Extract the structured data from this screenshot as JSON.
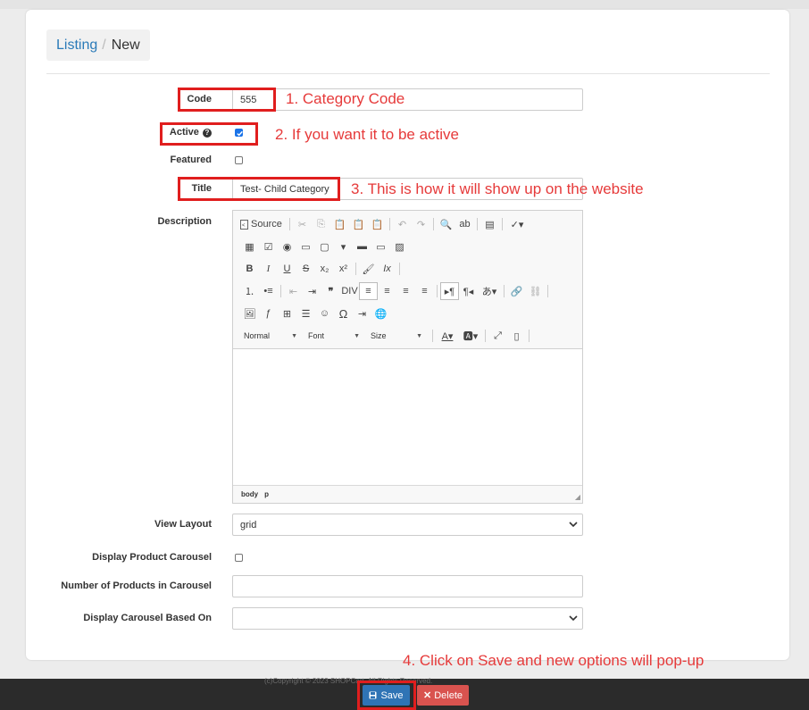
{
  "breadcrumb": {
    "link": "Listing",
    "separator": "/",
    "current": "New"
  },
  "form": {
    "code_label": "Code",
    "code_value": "555",
    "active_label": "Active",
    "active_checked": true,
    "featured_label": "Featured",
    "featured_checked": false,
    "title_label": "Title",
    "title_value": "Test- Child Category",
    "description_label": "Description",
    "view_layout_label": "View Layout",
    "view_layout_value": "grid",
    "display_carousel_label": "Display Product Carousel",
    "display_carousel_checked": false,
    "num_products_label": "Number of Products in Carousel",
    "num_products_value": "",
    "carousel_based_label": "Display Carousel Based On",
    "carousel_based_value": ""
  },
  "editor": {
    "source_label": "Source",
    "format_combo": "Normal",
    "font_combo": "Font",
    "size_combo": "Size",
    "status_body": "body",
    "status_p": "p"
  },
  "annotations": {
    "a1": "1. Category Code",
    "a2": "2. If you want it to be active",
    "a3": "3. This is how it will show up on the website",
    "a4": "4. Click on Save and new options will pop-up"
  },
  "footer": {
    "copyright": "(c)Copyright © 2023 SHOPCart. All Rights Reserved.",
    "save_label": "Save",
    "delete_label": "Delete"
  },
  "colors": {
    "annotation": "#e63a3a",
    "link": "#2a7ab8",
    "save": "#2f74b5",
    "delete": "#d9534f",
    "footer": "#2b2b2b"
  }
}
